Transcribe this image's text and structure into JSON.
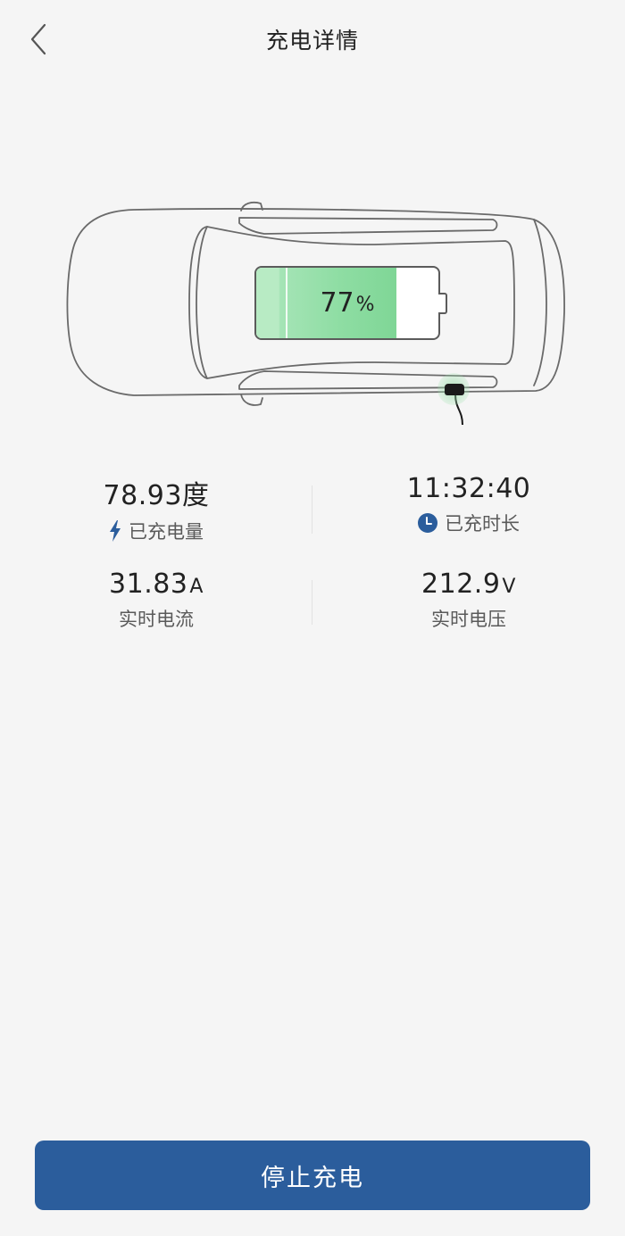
{
  "header": {
    "title": "充电详情"
  },
  "battery": {
    "percent_value": "77",
    "percent_unit": "%",
    "level": 0.77
  },
  "stats": {
    "charged_energy": {
      "value": "78.93",
      "unit": "度",
      "label": "已充电量",
      "icon": "lightning-icon"
    },
    "charged_time": {
      "value": "11:32:40",
      "label": "已充时长",
      "icon": "clock-icon"
    },
    "current": {
      "value": "31.83",
      "unit": "A",
      "label": "实时电流"
    },
    "voltage": {
      "value": "212.9",
      "unit": "V",
      "label": "实时电压"
    }
  },
  "actions": {
    "stop_label": "停止充电"
  },
  "colors": {
    "primary": "#2b5d9c",
    "battery_green": "#8edda3",
    "background": "#f5f5f5"
  }
}
